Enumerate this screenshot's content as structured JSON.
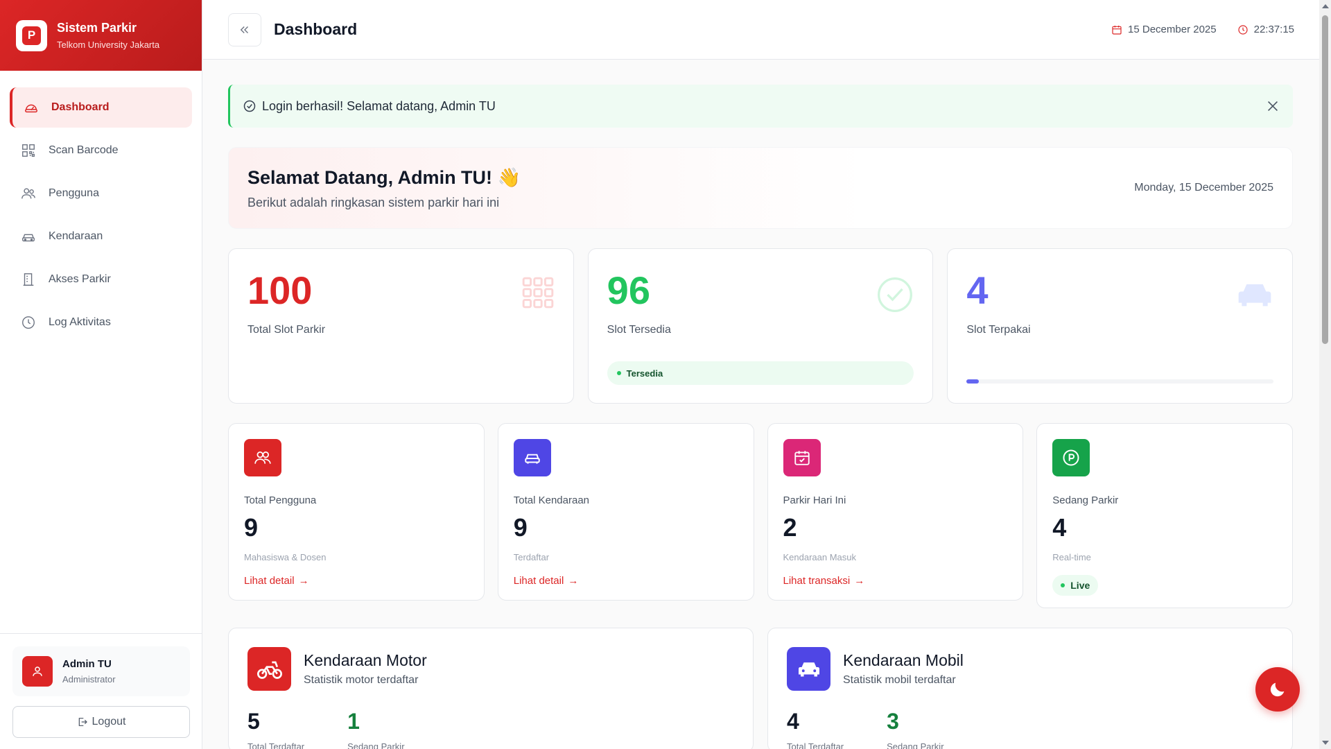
{
  "brand": {
    "title": "Sistem Parkir",
    "subtitle": "Telkom University Jakarta",
    "logo_letter": "P"
  },
  "sidebar": {
    "items": [
      {
        "label": "Dashboard",
        "icon": "gauge-icon",
        "active": true
      },
      {
        "label": "Scan Barcode",
        "icon": "qr-icon"
      },
      {
        "label": "Pengguna",
        "icon": "users-icon"
      },
      {
        "label": "Kendaraan",
        "icon": "car-icon"
      },
      {
        "label": "Akses Parkir",
        "icon": "building-icon"
      },
      {
        "label": "Log Aktivitas",
        "icon": "clock-icon"
      }
    ],
    "user": {
      "name": "Admin TU",
      "role": "Administrator"
    },
    "logout_label": "Logout"
  },
  "topbar": {
    "title": "Dashboard",
    "date": "15 December 2025",
    "time": "22:37:15"
  },
  "alert": {
    "message": "Login berhasil! Selamat datang, Admin TU"
  },
  "welcome": {
    "title": "Selamat Datang, Admin TU! 👋",
    "subtitle": "Berikut adalah ringkasan sistem parkir hari ini",
    "date": "Monday, 15 December 2025"
  },
  "stats": [
    {
      "value": "100",
      "label": "Total Slot Parkir",
      "color": "#dc2626"
    },
    {
      "value": "96",
      "label": "Slot Tersedia",
      "color": "#22c55e",
      "pill": "Tersedia"
    },
    {
      "value": "4",
      "label": "Slot Terpakai",
      "color": "#6366f1",
      "progress_percent": 4
    }
  ],
  "cards": [
    {
      "label": "Total Pengguna",
      "value": "9",
      "sub": "Mahasiswa & Dosen",
      "link": "Lihat detail",
      "color": "#dc2626"
    },
    {
      "label": "Total Kendaraan",
      "value": "9",
      "sub": "Terdaftar",
      "link": "Lihat detail",
      "color": "#4f46e5"
    },
    {
      "label": "Parkir Hari Ini",
      "value": "2",
      "sub": "Kendaraan Masuk",
      "link": "Lihat transaksi",
      "color": "#db2777"
    },
    {
      "label": "Sedang Parkir",
      "value": "4",
      "sub": "Real-time",
      "badge": "Live",
      "color": "#16a34a"
    }
  ],
  "vehicles": [
    {
      "title": "Kendaraan Motor",
      "subtitle": "Statistik motor terdaftar",
      "registered": "5",
      "registered_label": "Total Terdaftar",
      "parked": "1",
      "parked_label": "Sedang Parkir",
      "color": "#dc2626"
    },
    {
      "title": "Kendaraan Mobil",
      "subtitle": "Statistik mobil terdaftar",
      "registered": "4",
      "registered_label": "Total Terdaftar",
      "parked": "3",
      "parked_label": "Sedang Parkir",
      "color": "#4f46e5"
    }
  ],
  "colors": {
    "accent": "#dc2626",
    "success": "#22c55e",
    "indigo": "#6366f1",
    "parked_green": "#15803d"
  }
}
